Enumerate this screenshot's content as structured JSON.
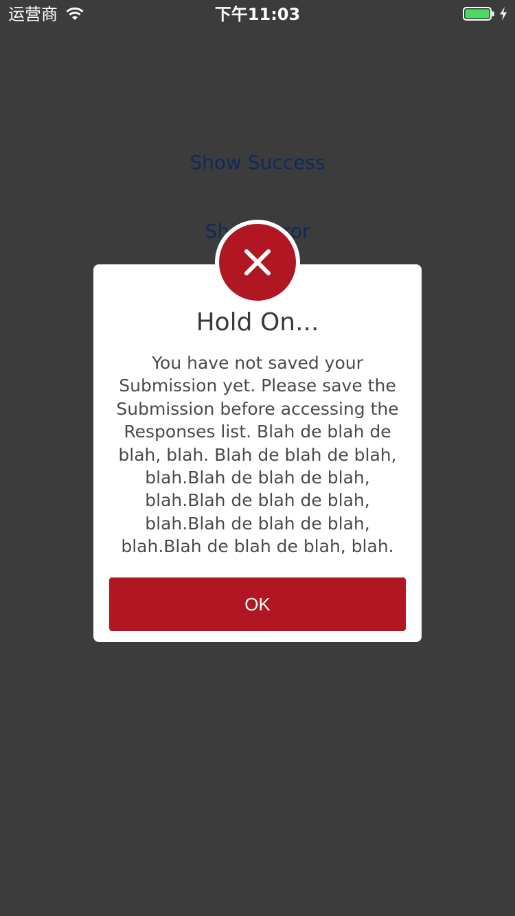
{
  "status_bar": {
    "carrier": "运营商",
    "time": "下午11:03",
    "wifi_icon": "wifi-icon",
    "battery_icon": "battery-icon",
    "charging_icon": "charging-bolt-icon",
    "battery_color": "#4cd964"
  },
  "background": {
    "show_success_label": "Show Success",
    "show_error_label": "Show Error",
    "link_color": "#0f2a5a",
    "overlay_color": "#3c3c3c"
  },
  "dialog": {
    "icon": "close-x-icon",
    "accent_color": "#b01723",
    "title": "Hold On...",
    "message": "You have not saved your Submission yet. Please save the Submission before accessing the Responses list. Blah de blah de blah, blah. Blah de blah de blah, blah.Blah de blah de blah, blah.Blah de blah de blah, blah.Blah de blah de blah, blah.Blah de blah de blah, blah.",
    "ok_label": "OK"
  }
}
